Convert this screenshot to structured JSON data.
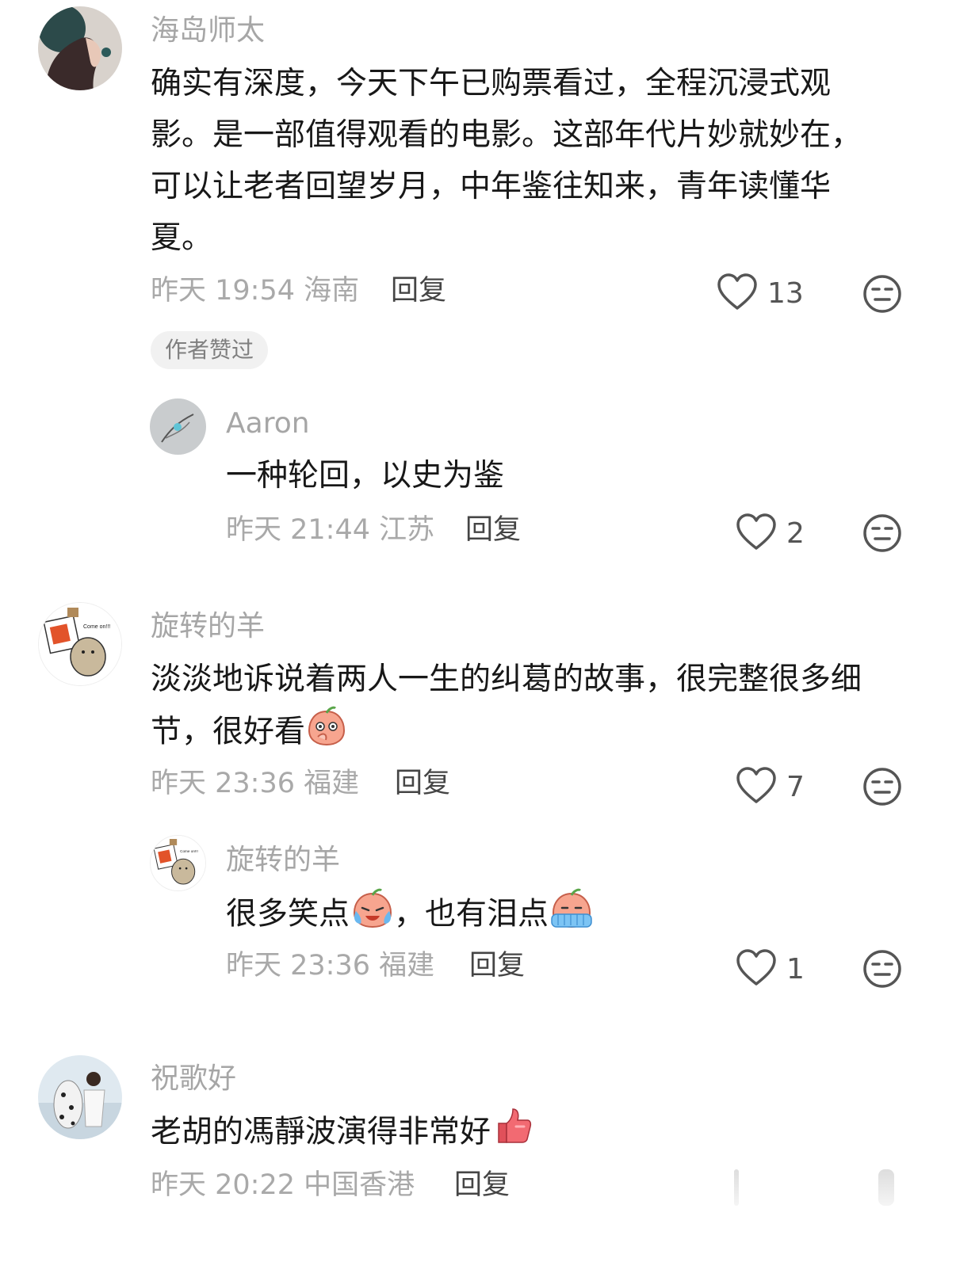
{
  "comments": [
    {
      "user": "海岛师太",
      "text": "确实有深度，今天下午已购票看过，全程沉浸式观影。是一部值得观看的电影。这部年代片妙就妙在，可以让老者回望岁月，中年鉴往知来，青年读懂华夏。",
      "lines": [
        "确实有深度，今天下午已购票看过，全程沉浸式观",
        "影。是一部值得观看的电影。这部年代片妙就妙在，",
        "可以让老者回望岁月，中年鉴往知来，青年读懂华",
        "夏。"
      ],
      "meta": "昨天 19:54 海南",
      "reply": "回复",
      "likes": "13",
      "badge": "作者赞过",
      "replies": [
        {
          "user": "Aaron",
          "text": "一种轮回，以史为鉴",
          "meta": "昨天 21:44 江苏",
          "reply": "回复",
          "likes": "2"
        }
      ]
    },
    {
      "user": "旋转的羊",
      "text": "淡淡地诉说着两人一生的纠葛的故事，很完整很多细节，很好看",
      "lines": [
        "淡淡地诉说着两人一生的纠葛的故事，很完整很多细",
        "节，很好看"
      ],
      "emoji": "shy-peach-emoji",
      "meta": "昨天 23:36 福建",
      "reply": "回复",
      "likes": "7",
      "avatar_text": "Come on!!!",
      "replies": [
        {
          "user": "旋转的羊",
          "text_parts": [
            "很多笑点",
            "，也有泪点"
          ],
          "emojis": [
            "laugh-cry-peach-emoji",
            "crying-peach-emoji"
          ],
          "meta": "昨天 23:36 福建",
          "reply": "回复",
          "likes": "1",
          "avatar_text": "Come on!!!"
        }
      ]
    },
    {
      "user": "祝歌好",
      "text": "老胡的馮靜波演得非常好",
      "emoji": "thumbs-up-emoji",
      "meta": "昨天 20:22 中国香港",
      "reply": "回复"
    }
  ],
  "colors": {
    "username": "#a6a6a6",
    "text": "#181818",
    "meta": "#a9a9a9",
    "badge_bg": "#f1f1f1"
  }
}
